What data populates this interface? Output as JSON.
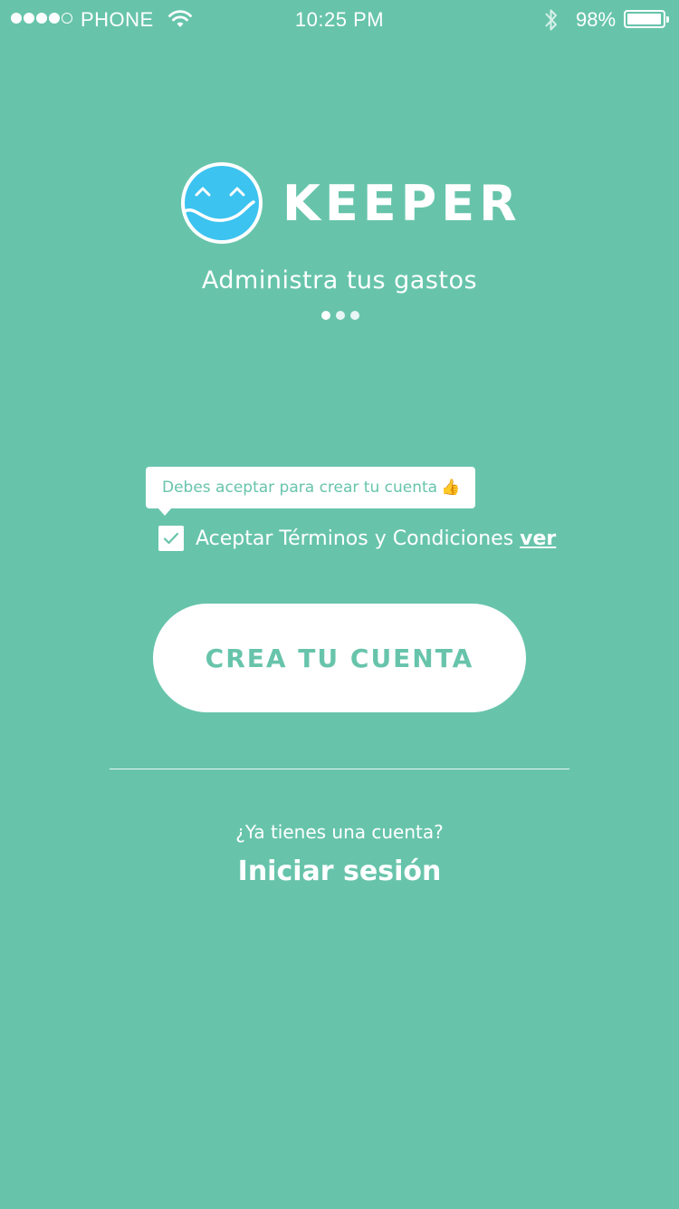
{
  "status_bar": {
    "carrier": "PHONE",
    "time": "10:25 PM",
    "battery": "98%",
    "battery_level": 0.98,
    "signal_bars": 4,
    "signal_total": 5
  },
  "brand": {
    "name": "KEEPER",
    "logo_icon": "smiley-wave-logo-icon",
    "logo_color": "#3cc3f0"
  },
  "tagline": "Administra tus gastos",
  "carousel": {
    "pages": 3,
    "active_index": 0
  },
  "tooltip": {
    "text": "Debes aceptar para crear tu cuenta",
    "emoji": "👍"
  },
  "terms": {
    "label": "Aceptar Términos y Condiciones",
    "link": "ver",
    "checked": true
  },
  "cta": {
    "label": "CREA TU CUENTA"
  },
  "login_prompt": {
    "question": "¿Ya tienes una cuenta?",
    "link": "Iniciar sesión"
  },
  "colors": {
    "background": "#67c4ab",
    "accent": "#67c4ab",
    "logo": "#3cc3f0",
    "text": "#ffffff"
  }
}
